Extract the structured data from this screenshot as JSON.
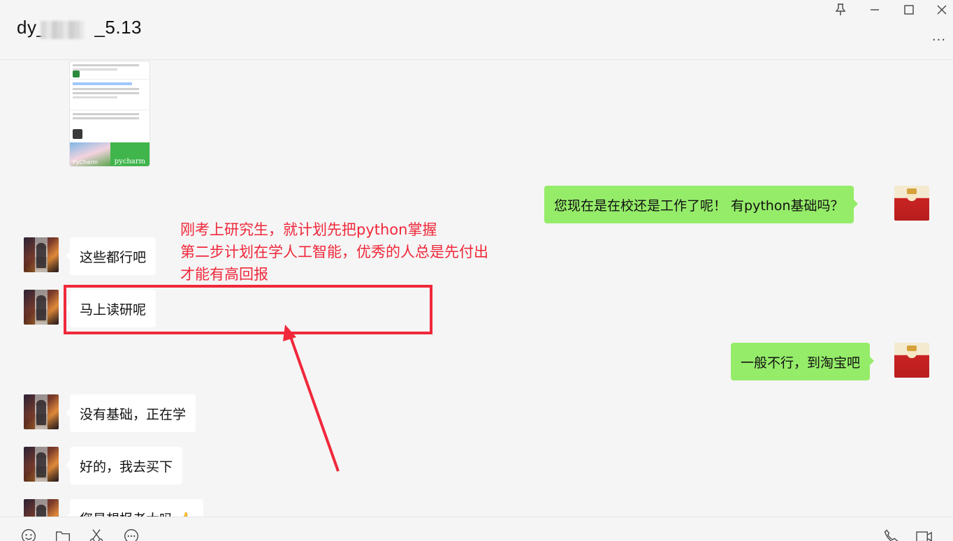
{
  "window": {
    "title": "dy_        _5.13",
    "title_prefix": "dy_",
    "title_suffix": "_5.13",
    "more_label": "..."
  },
  "shared_card": {
    "image_left_label": "PyCharm",
    "image_right_label": "pycharm"
  },
  "messages": [
    {
      "side": "out",
      "text": "您现在是在校还是工作了呢！ 有python基础吗？"
    },
    {
      "side": "in",
      "text": "这些都行吧"
    },
    {
      "side": "in",
      "text": "马上读研呢"
    },
    {
      "side": "out",
      "text": "一般不行，到淘宝吧"
    },
    {
      "side": "in",
      "text": "没有基础，正在学"
    },
    {
      "side": "in",
      "text": "好的，我去买下"
    },
    {
      "side": "in",
      "text": "您是想报老大吗 👍"
    }
  ],
  "annotation": {
    "lines": [
      "刚考上研究生，就计划先把python掌握",
      "第二步计划在学人工智能，优秀的人总是先付出",
      "才能有高回报"
    ],
    "color": "#f0283a"
  },
  "colors": {
    "outgoing_bubble": "#95ec69",
    "incoming_bubble": "#ffffff",
    "background": "#f5f5f5"
  },
  "icons": {
    "pin": "pin-icon",
    "minimize": "minimize-icon",
    "maximize": "maximize-icon",
    "close": "close-icon",
    "emoji": "emoji-icon",
    "folder": "folder-icon",
    "scissors": "scissors-icon",
    "chat": "chat-bubble-icon",
    "phone": "phone-icon",
    "video": "video-call-icon"
  }
}
